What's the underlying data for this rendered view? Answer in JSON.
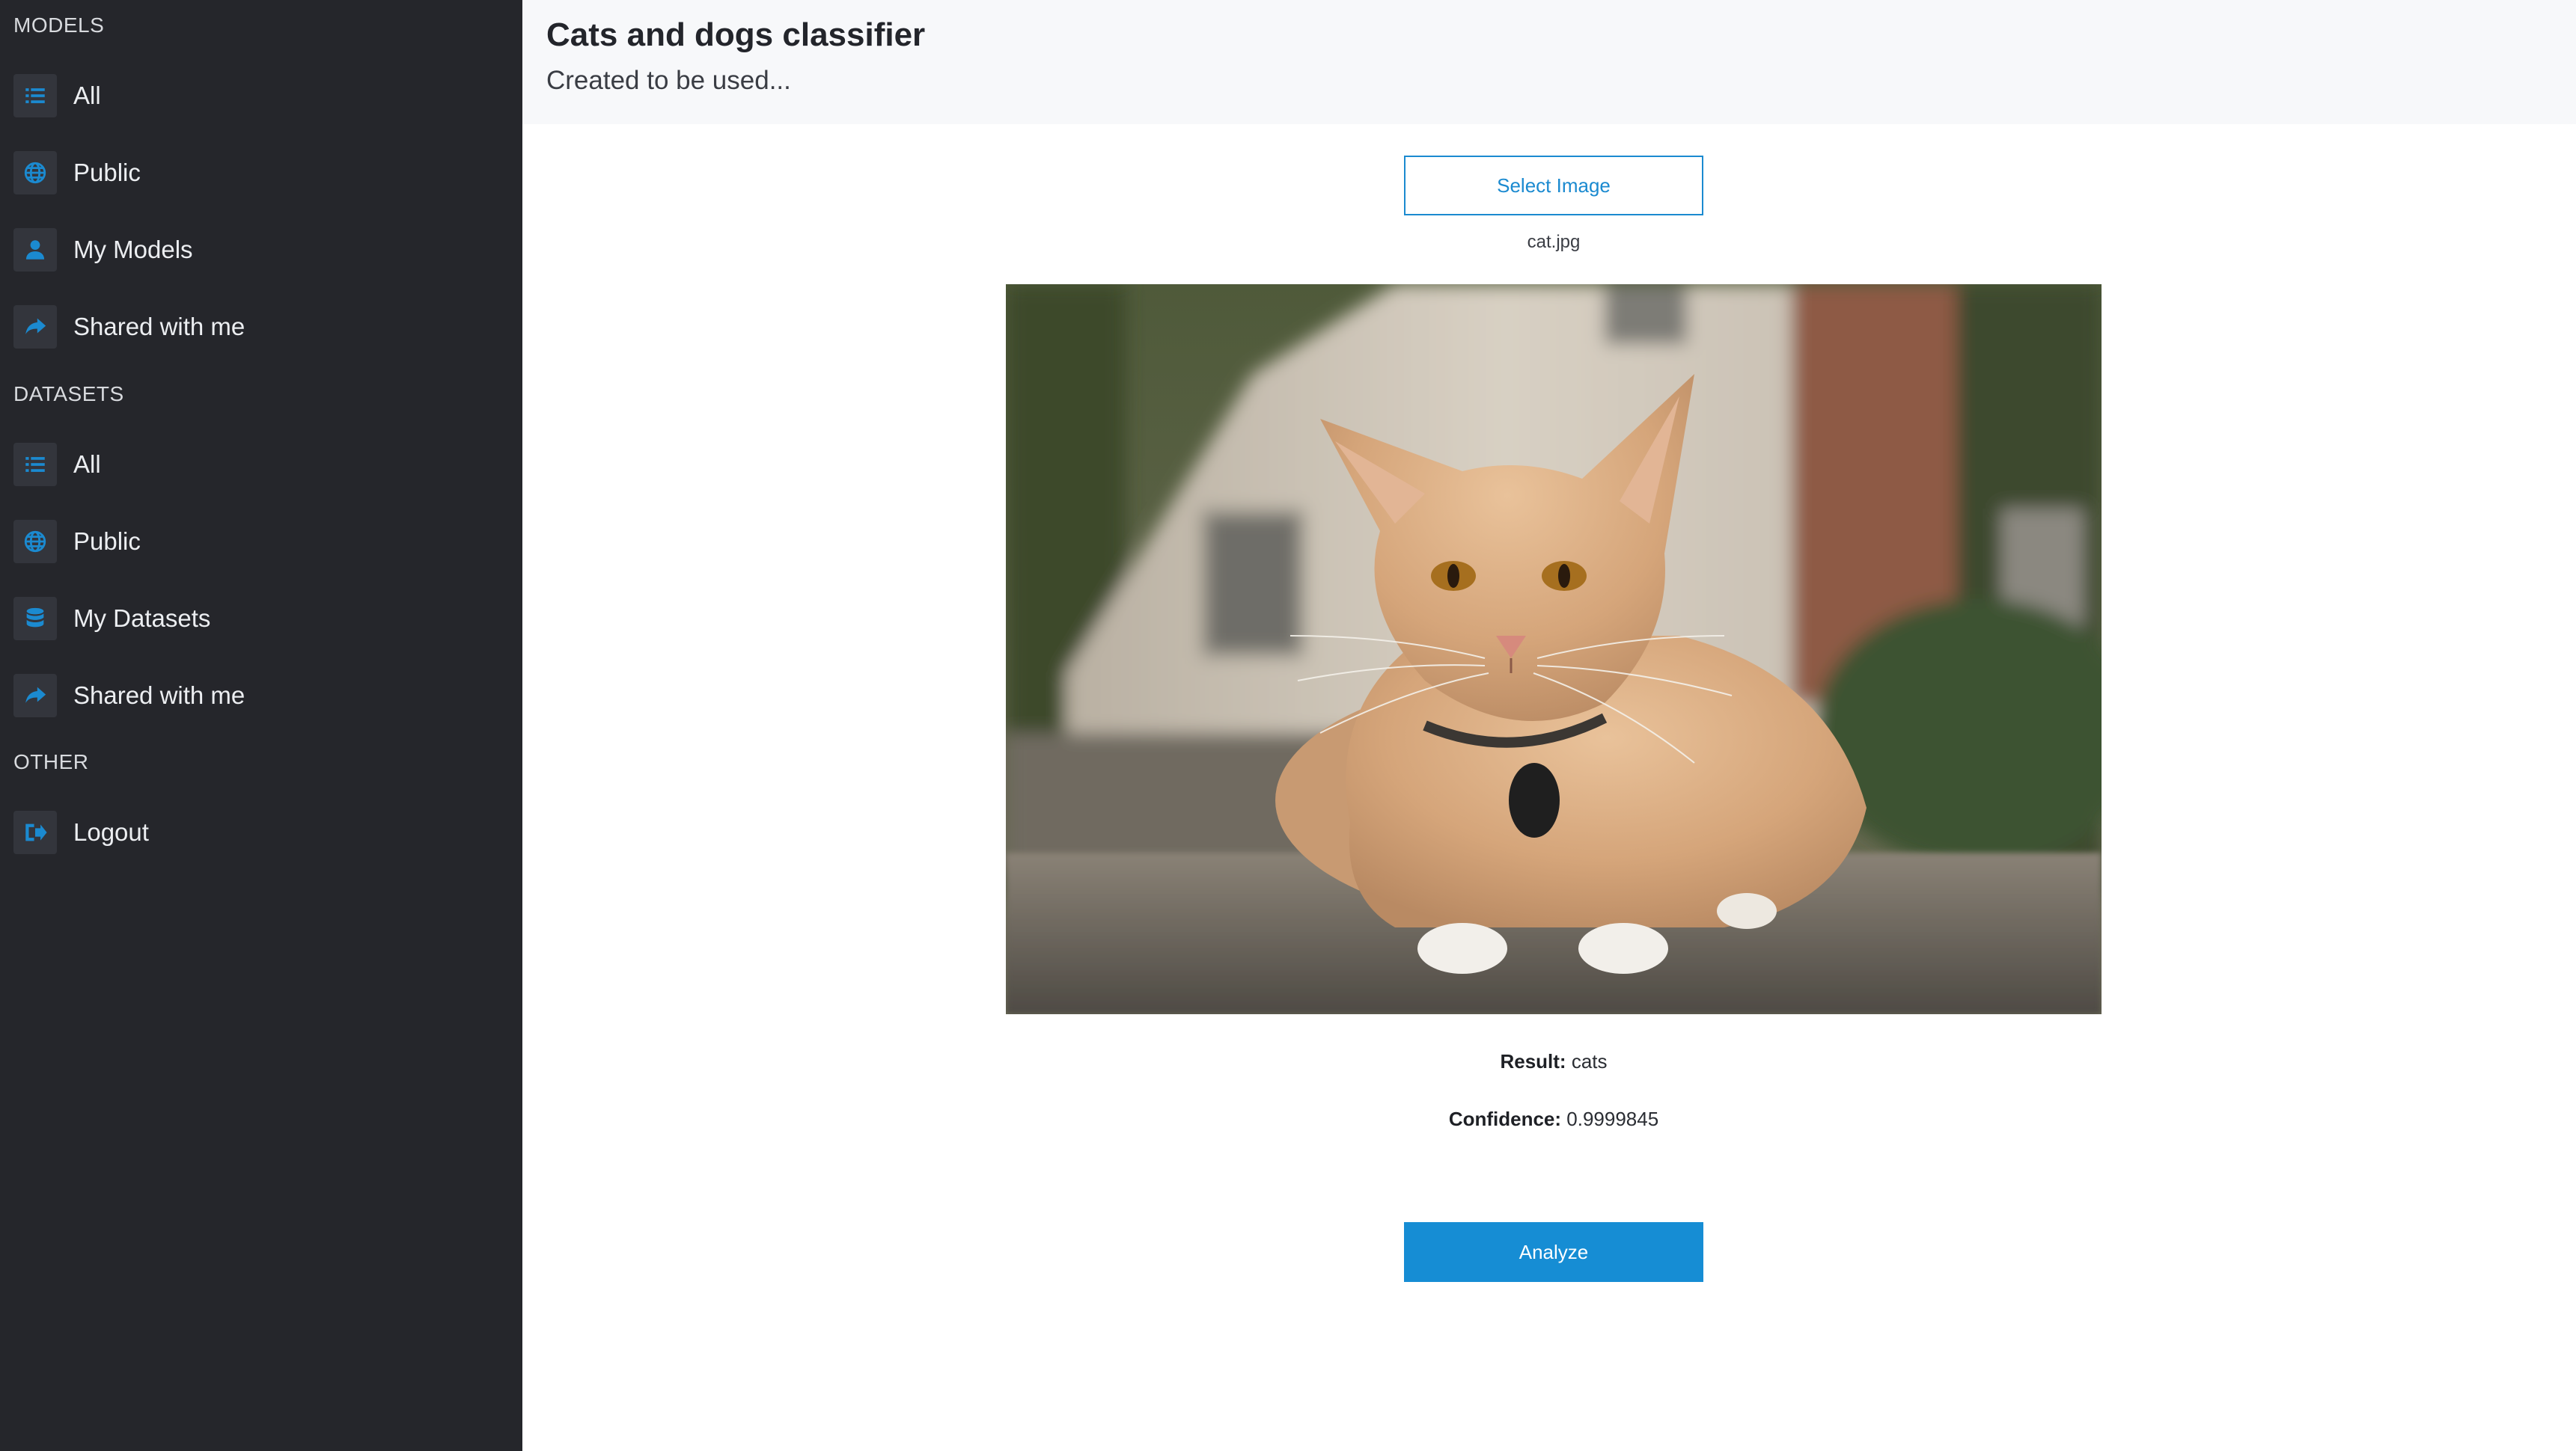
{
  "sidebar": {
    "sections": {
      "models": {
        "header": "MODELS",
        "items": [
          {
            "label": "All",
            "icon": "list-icon"
          },
          {
            "label": "Public",
            "icon": "globe-icon"
          },
          {
            "label": "My Models",
            "icon": "user-icon"
          },
          {
            "label": "Shared with me",
            "icon": "share-icon"
          }
        ]
      },
      "datasets": {
        "header": "DATASETS",
        "items": [
          {
            "label": "All",
            "icon": "list-icon"
          },
          {
            "label": "Public",
            "icon": "globe-icon"
          },
          {
            "label": "My Datasets",
            "icon": "database-icon"
          },
          {
            "label": "Shared with me",
            "icon": "share-icon"
          }
        ]
      },
      "other": {
        "header": "OTHER",
        "items": [
          {
            "label": "Logout",
            "icon": "logout-icon"
          }
        ]
      }
    }
  },
  "header": {
    "title": "Cats and dogs classifier",
    "subtitle": "Created to be used..."
  },
  "main": {
    "select_button_label": "Select Image",
    "filename": "cat.jpg",
    "result": {
      "label": "Result:",
      "value": "cats"
    },
    "confidence": {
      "label": "Confidence:",
      "value": "0.9999845"
    },
    "analyze_button_label": "Analyze"
  },
  "colors": {
    "sidebar_bg": "#25262b",
    "accent": "#168dd4",
    "header_bg": "#f7f8fa"
  }
}
